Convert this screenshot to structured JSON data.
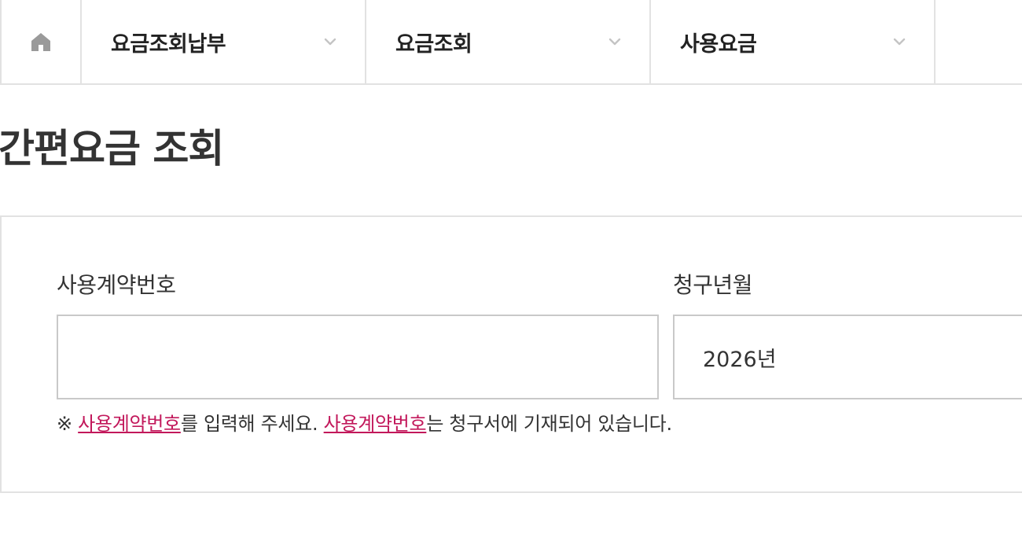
{
  "breadcrumb": {
    "home_icon": "home-icon",
    "items": [
      {
        "label": "요금조회납부",
        "icon": "chevron-down-icon"
      },
      {
        "label": "요금조회",
        "icon": "chevron-down-icon"
      },
      {
        "label": "사용요금",
        "icon": "chevron-down-icon"
      }
    ]
  },
  "page": {
    "title": "간편요금 조회"
  },
  "form": {
    "contract_label": "사용계약번호",
    "contract_value": "",
    "period_label": "청구년월",
    "period_year": "2026년"
  },
  "notice": {
    "mark": "※",
    "link1": "사용계약번호",
    "text1": "를 입력해 주세요.",
    "link2": "사용계약번호",
    "text2": "는 청구서에 기재되어 있습니다."
  },
  "colors": {
    "accent_link": "#c2185b",
    "border": "#e2e2e2",
    "chevron": "#c4c4c4",
    "home_icon": "#9a9a9a"
  }
}
